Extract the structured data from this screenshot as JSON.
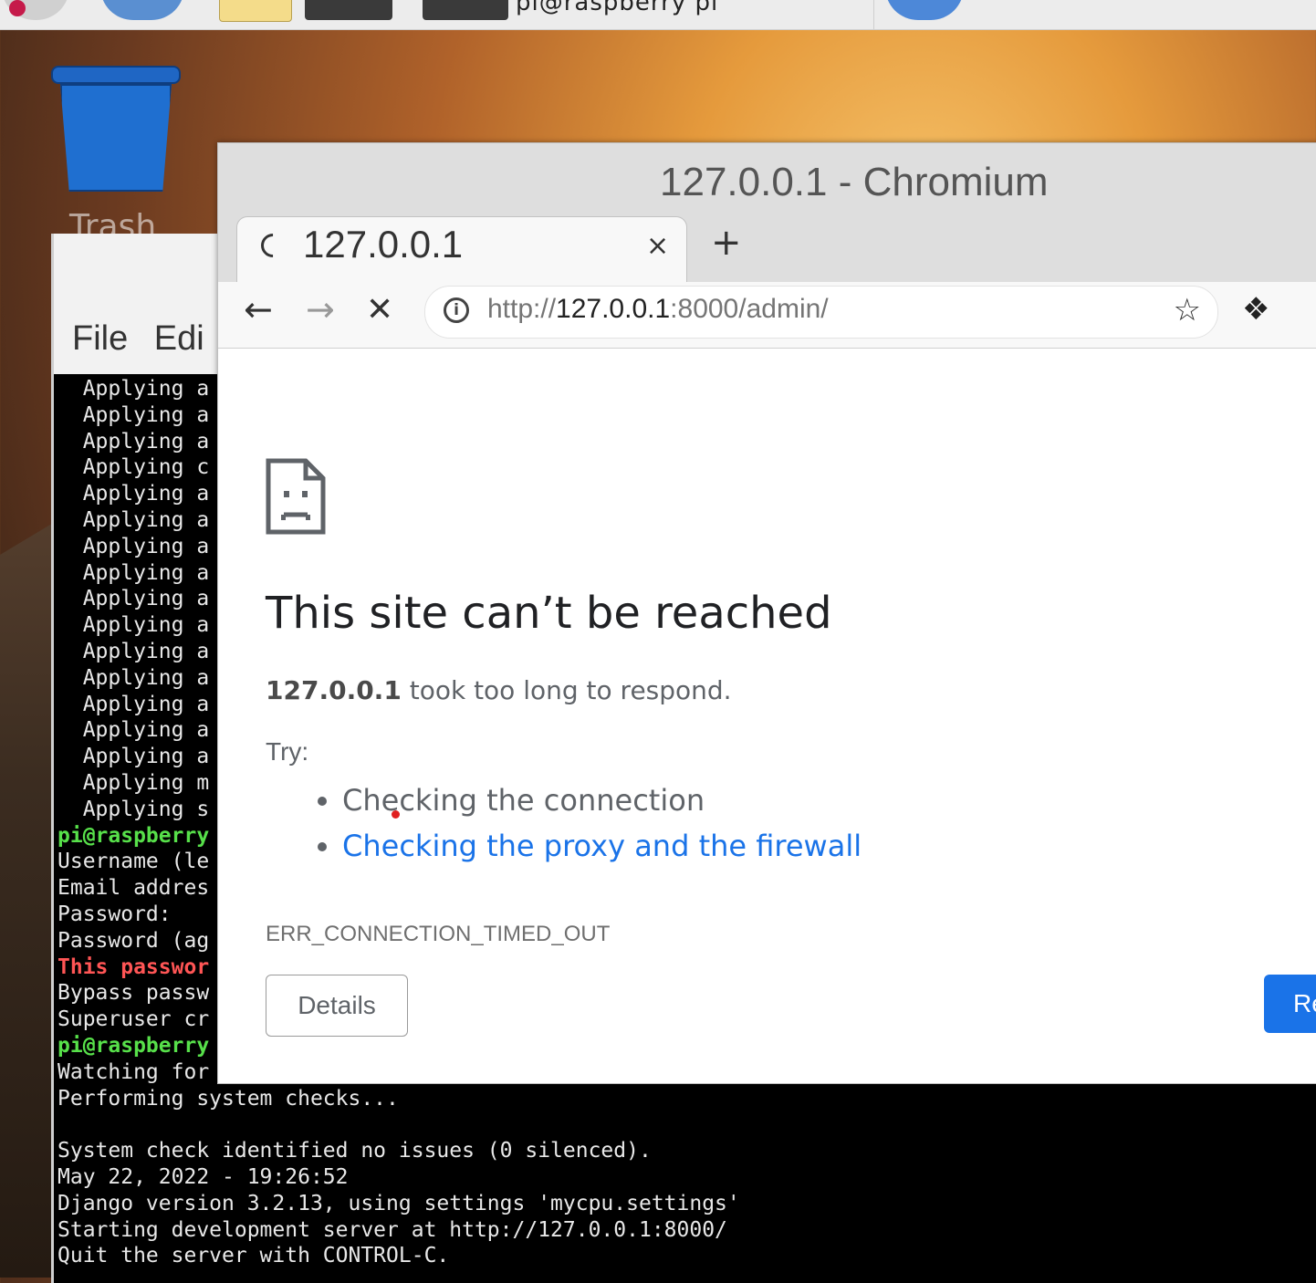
{
  "taskbar": {
    "window_label": "pi@raspberry pi"
  },
  "desktop": {
    "trash_label": "Trash"
  },
  "terminal": {
    "menu": [
      "File",
      "Edi"
    ],
    "lines": [
      {
        "text": "  Applying a",
        "style": ""
      },
      {
        "text": "  Applying a",
        "style": ""
      },
      {
        "text": "  Applying a",
        "style": ""
      },
      {
        "text": "  Applying c",
        "style": ""
      },
      {
        "text": "  Applying a",
        "style": ""
      },
      {
        "text": "  Applying a",
        "style": ""
      },
      {
        "text": "  Applying a",
        "style": ""
      },
      {
        "text": "  Applying a",
        "style": ""
      },
      {
        "text": "  Applying a",
        "style": ""
      },
      {
        "text": "  Applying a",
        "style": ""
      },
      {
        "text": "  Applying a",
        "style": ""
      },
      {
        "text": "  Applying a",
        "style": ""
      },
      {
        "text": "  Applying a",
        "style": ""
      },
      {
        "text": "  Applying a",
        "style": ""
      },
      {
        "text": "  Applying a",
        "style": ""
      },
      {
        "text": "  Applying m",
        "style": ""
      },
      {
        "text": "  Applying s",
        "style": ""
      },
      {
        "text": "pi@raspberry",
        "style": "green"
      },
      {
        "text": "Username (le",
        "style": ""
      },
      {
        "text": "Email addres",
        "style": ""
      },
      {
        "text": "Password:",
        "style": ""
      },
      {
        "text": "Password (ag",
        "style": ""
      },
      {
        "text": "This passwor",
        "style": "red"
      },
      {
        "text": "Bypass passw",
        "style": ""
      },
      {
        "text": "Superuser cr",
        "style": ""
      },
      {
        "text": "pi@raspberry",
        "style": "green"
      },
      {
        "text": "Watching for",
        "style": ""
      },
      {
        "text": "Performing system checks...",
        "style": ""
      },
      {
        "text": "",
        "style": ""
      },
      {
        "text": "System check identified no issues (0 silenced).",
        "style": ""
      },
      {
        "text": "May 22, 2022 - 19:26:52",
        "style": ""
      },
      {
        "text": "Django version 3.2.13, using settings 'mycpu.settings'",
        "style": ""
      },
      {
        "text": "Starting development server at http://127.0.0.1:8000/",
        "style": ""
      },
      {
        "text": "Quit the server with CONTROL-C.",
        "style": ""
      }
    ]
  },
  "browser": {
    "window_title": "127.0.0.1 - Chromium",
    "tab_title": "127.0.0.1",
    "tab_close": "×",
    "new_tab": "+",
    "url_scheme": "http://",
    "url_host": "127.0.0.1",
    "url_rest": ":8000/admin/",
    "page": {
      "title": "This site can’t be reached",
      "host": "127.0.0.1",
      "desc": " took too long to respond.",
      "try_label": "Try:",
      "suggestion_1": "Checking the connection",
      "suggestion_2": "Checking the proxy and the firewall",
      "error_code": "ERR_CONNECTION_TIMED_OUT",
      "details_button": "Details",
      "reload_button": "Re"
    },
    "colors": {
      "link": "#1a73e8",
      "primary_button": "#1a73e8"
    }
  }
}
